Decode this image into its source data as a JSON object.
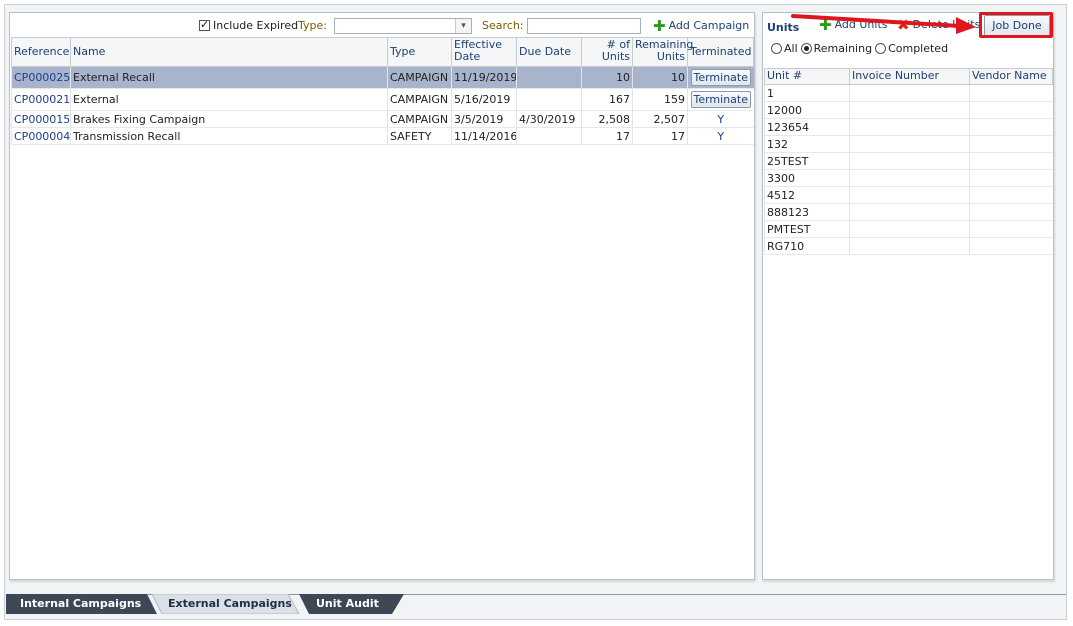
{
  "toolbar": {
    "include_expired_label": "Include Expired",
    "include_expired_checked": true,
    "type_label": "Type:",
    "type_value": "",
    "search_label": "Search:",
    "search_value": "",
    "add_campaign_label": "Add Campaign"
  },
  "campaigns": {
    "headers": {
      "reference": "Reference",
      "name": "Name",
      "type": "Type",
      "effective_date_1": "Effective",
      "effective_date_2": "Date",
      "due_date": "Due Date",
      "num_units_1": "# of",
      "num_units_2": "Units",
      "remaining_1": "Remaining",
      "remaining_2": "Units",
      "terminated": "Terminated"
    },
    "rows": [
      {
        "reference": "CP000025",
        "name": "External Recall",
        "type": "CAMPAIGN",
        "effective": "11/19/2019",
        "due": "",
        "units": "10",
        "remaining": "10",
        "terminated": "Terminate",
        "terminate_button": true
      },
      {
        "reference": "CP000021",
        "name": "External",
        "type": "CAMPAIGN",
        "effective": "5/16/2019",
        "due": "",
        "units": "167",
        "remaining": "159",
        "terminated": "Terminate",
        "terminate_button": true
      },
      {
        "reference": "CP000015",
        "name": "Brakes Fixing Campaign",
        "type": "CAMPAIGN",
        "effective": "3/5/2019",
        "due": "4/30/2019",
        "units": "2,508",
        "remaining": "2,507",
        "terminated": "Y",
        "terminate_button": false
      },
      {
        "reference": "CP000004",
        "name": "Transmission Recall",
        "type": "SAFETY",
        "effective": "11/14/2016",
        "due": "",
        "units": "17",
        "remaining": "17",
        "terminated": "Y",
        "terminate_button": false
      }
    ]
  },
  "units_panel": {
    "title": "Units",
    "add_units_label": "Add Units",
    "delete_units_label": "Delete Units",
    "job_done_label": "Job Done",
    "filters": [
      {
        "label": "All",
        "selected": false
      },
      {
        "label": "Remaining",
        "selected": true
      },
      {
        "label": "Completed",
        "selected": false
      }
    ],
    "headers": {
      "unit": "Unit #",
      "invoice": "Invoice Number",
      "vendor": "Vendor Name"
    },
    "rows": [
      {
        "unit": "1",
        "invoice": "",
        "vendor": ""
      },
      {
        "unit": "12000",
        "invoice": "",
        "vendor": ""
      },
      {
        "unit": "123654",
        "invoice": "",
        "vendor": ""
      },
      {
        "unit": "132",
        "invoice": "",
        "vendor": ""
      },
      {
        "unit": "25TEST",
        "invoice": "",
        "vendor": ""
      },
      {
        "unit": "3300",
        "invoice": "",
        "vendor": ""
      },
      {
        "unit": "4512",
        "invoice": "",
        "vendor": ""
      },
      {
        "unit": "888123",
        "invoice": "",
        "vendor": ""
      },
      {
        "unit": "PMTEST",
        "invoice": "",
        "vendor": ""
      },
      {
        "unit": "RG710",
        "invoice": "",
        "vendor": ""
      }
    ]
  },
  "tabs": [
    {
      "label": "Internal Campaigns",
      "active": false
    },
    {
      "label": "External Campaigns",
      "active": true
    },
    {
      "label": "Unit Audit",
      "active": false
    }
  ],
  "colors": {
    "annotation_red": "#e0161d",
    "selected_row": "#a7b4cc",
    "tab_dark": "#3d4756",
    "tab_light": "#dbe0e6",
    "link_blue": "#1e3f8f"
  }
}
